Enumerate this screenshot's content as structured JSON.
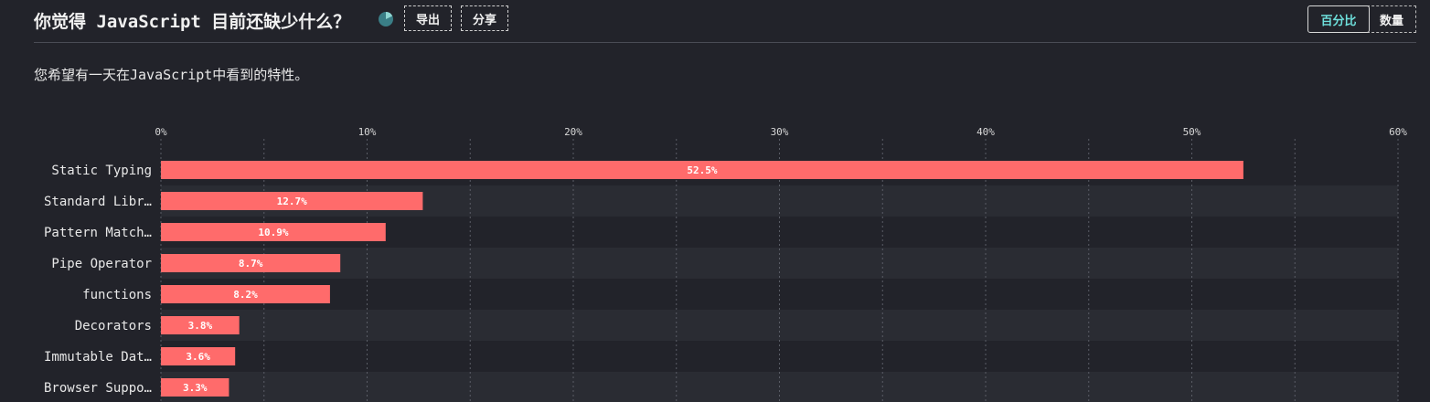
{
  "header": {
    "title": "你觉得 JavaScript 目前还缺少什么？",
    "export_label": "导出",
    "share_label": "分享",
    "toggle_percent": "百分比",
    "toggle_count": "数量"
  },
  "subtitle": "您希望有一天在JavaScript中看到的特性。",
  "colors": {
    "bar": "#ff6b6b",
    "background": "#22232a",
    "band": "#2a2c33",
    "accent": "#6ee0dc"
  },
  "chart_data": {
    "type": "bar",
    "orientation": "horizontal",
    "categories": [
      "Static Typing",
      "Standard Libr…",
      "Pattern Match…",
      "Pipe Operator",
      "functions",
      "Decorators",
      "Immutable Dat…",
      "Browser Suppo…"
    ],
    "values": [
      52.5,
      12.7,
      10.9,
      8.7,
      8.2,
      3.8,
      3.6,
      3.3
    ],
    "value_labels": [
      "52.5%",
      "12.7%",
      "10.9%",
      "8.7%",
      "8.2%",
      "3.8%",
      "3.6%",
      "3.3%"
    ],
    "xlim": [
      0,
      60
    ],
    "ticks": [
      0,
      10,
      20,
      30,
      40,
      50,
      60
    ],
    "tick_labels": [
      "0%",
      "10%",
      "20%",
      "30%",
      "40%",
      "50%",
      "60%"
    ],
    "grid": true
  }
}
